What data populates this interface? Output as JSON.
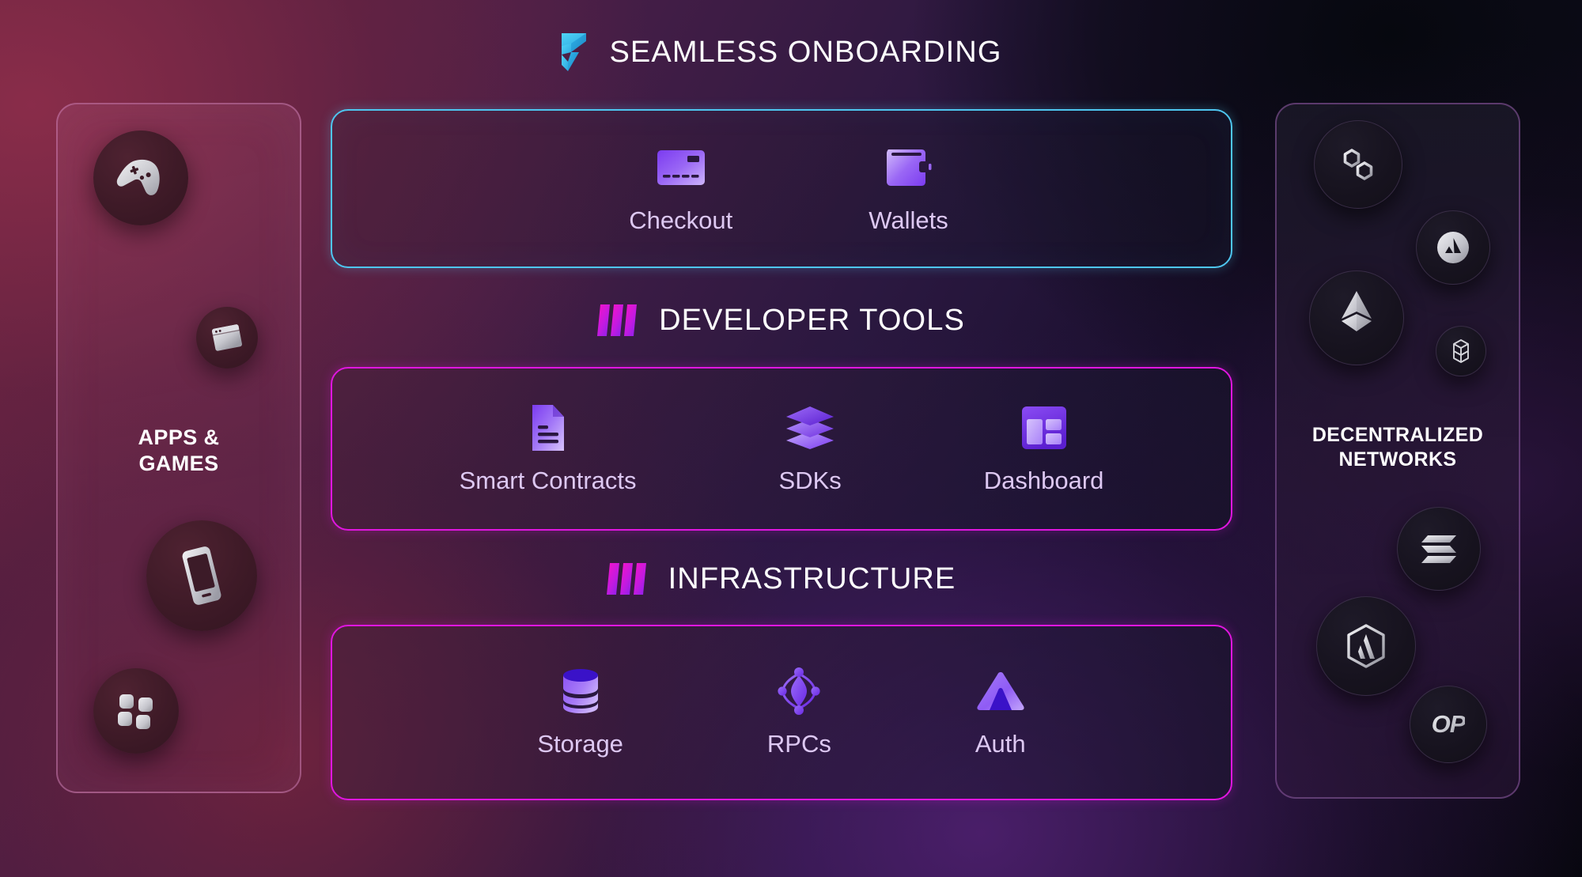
{
  "theme": {
    "accent_cyan": "#4ec6f0",
    "accent_magenta": "#e016e0",
    "icon_purple": "#7c3aed",
    "label_text": "#ddc8f2",
    "panel_border_left": "#cc7eb2",
    "panel_border_right": "#8c58a0"
  },
  "left_panel": {
    "label": "APPS &\nGAMES",
    "label_line1": "APPS &",
    "label_line2": "GAMES",
    "chips": [
      {
        "name": "gamepad-icon",
        "label": "Gamepad"
      },
      {
        "name": "browser-window-icon",
        "label": "Browser Window"
      },
      {
        "name": "mobile-phone-icon",
        "label": "Mobile Phone"
      },
      {
        "name": "apps-grid-icon",
        "label": "Apps Grid"
      }
    ]
  },
  "right_panel": {
    "label_line1": "DECENTRALIZED",
    "label_line2": "NETWORKS",
    "chips": [
      {
        "name": "polygon-logo-icon",
        "label": "Polygon"
      },
      {
        "name": "avalanche-logo-icon",
        "label": "Avalanche"
      },
      {
        "name": "ethereum-logo-icon",
        "label": "Ethereum"
      },
      {
        "name": "fantom-logo-icon",
        "label": "Fantom"
      },
      {
        "name": "solana-logo-icon",
        "label": "Solana"
      },
      {
        "name": "arbitrum-logo-icon",
        "label": "Arbitrum"
      },
      {
        "name": "optimism-logo-icon",
        "label": "OP"
      }
    ],
    "optimism_text": "OP"
  },
  "sections": [
    {
      "id": "onboarding",
      "heading": "SEAMLESS ONBOARDING",
      "heading_icon": "thirdweb-logo-icon",
      "border_color": "#4ec6f0",
      "items": [
        {
          "label": "Checkout",
          "icon": "credit-card-icon"
        },
        {
          "label": "Wallets",
          "icon": "wallet-icon"
        }
      ]
    },
    {
      "id": "devtools",
      "heading": "DEVELOPER TOOLS",
      "heading_icon": "triple-bars-icon",
      "border_color": "#e016e0",
      "items": [
        {
          "label": "Smart Contracts",
          "icon": "document-contract-icon"
        },
        {
          "label": "SDKs",
          "icon": "stacked-layers-icon"
        },
        {
          "label": "Dashboard",
          "icon": "dashboard-layout-icon"
        }
      ]
    },
    {
      "id": "infrastructure",
      "heading": "INFRASTRUCTURE",
      "heading_icon": "triple-bars-icon",
      "border_color": "#e016e0",
      "items": [
        {
          "label": "Storage",
          "icon": "database-cylinder-icon"
        },
        {
          "label": "RPCs",
          "icon": "network-node-icon"
        },
        {
          "label": "Auth",
          "icon": "auth-triangle-icon"
        }
      ]
    }
  ]
}
